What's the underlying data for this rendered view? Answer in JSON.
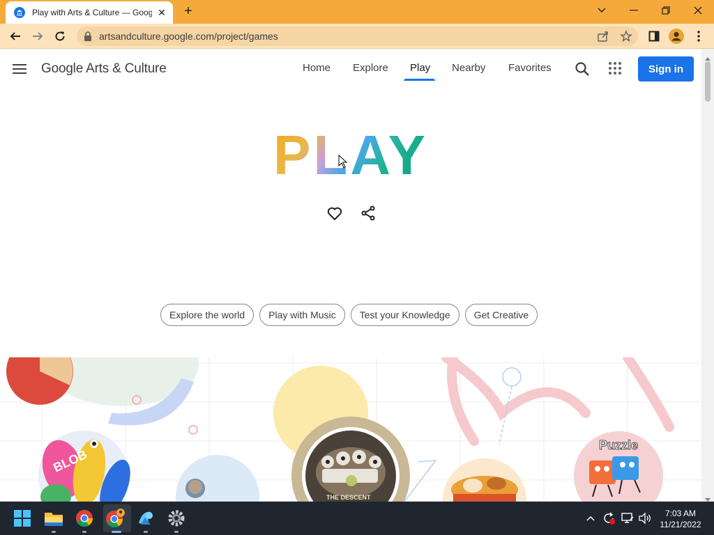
{
  "browser": {
    "tab_title": "Play with Arts & Culture — Goog",
    "url": "artsandculture.google.com/project/games"
  },
  "header": {
    "logo": "Google Arts & Culture",
    "nav": [
      "Home",
      "Explore",
      "Play",
      "Nearby",
      "Favorites"
    ],
    "active_nav": "Play",
    "signin_label": "Sign in"
  },
  "hero": {
    "title": "PLAY"
  },
  "chips": [
    "Explore the world",
    "Play with Music",
    "Test your Knowledge",
    "Get Creative"
  ],
  "games": {
    "blob_label": "BLOB",
    "descent_label": "THE DESCENT",
    "puzzle_label": "Puzzle"
  },
  "taskbar": {
    "time": "7:03 AM",
    "date": "11/21/2022"
  },
  "colors": {
    "accent": "#1a73e8",
    "titlebar": "#f6a93b",
    "toolbar": "#fde3bb",
    "taskbar": "#1f2630"
  }
}
